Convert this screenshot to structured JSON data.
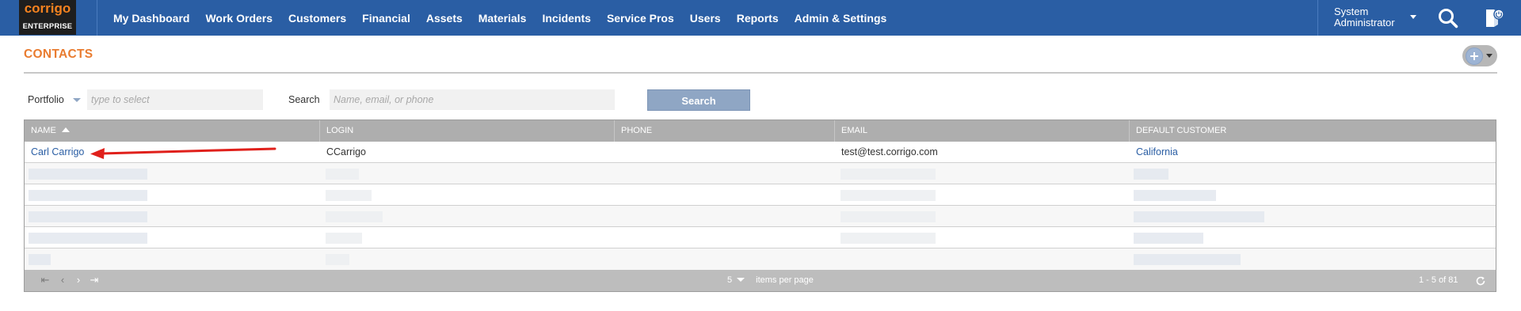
{
  "app": {
    "logo_text": "corrigo",
    "logo_sub": "ENTERPRISE",
    "nav": [
      "My Dashboard",
      "Work Orders",
      "Customers",
      "Financial",
      "Assets",
      "Materials",
      "Incidents",
      "Service Pros",
      "Users",
      "Reports",
      "Admin & Settings"
    ],
    "user_line1": "System",
    "user_line2": "Administrator",
    "icons": [
      "search-icon",
      "logout-icon"
    ]
  },
  "page": {
    "title": "CONTACTS"
  },
  "filters": {
    "portfolio_label": "Portfolio",
    "portfolio_placeholder": "type to select",
    "search_label": "Search",
    "search_placeholder": "Name, email, or phone",
    "search_button": "Search"
  },
  "grid": {
    "columns": [
      "NAME",
      "LOGIN",
      "PHONE",
      "EMAIL",
      "DEFAULT CUSTOMER"
    ],
    "sorted_column": "NAME",
    "sort_direction": "ascending",
    "rows": [
      {
        "name": "Carl Carrigo",
        "login": "CCarrigo",
        "phone": "",
        "email": "test@test.corrigo.com",
        "default_customer": "California"
      }
    ],
    "redacted_rows": 5,
    "page_size": "5",
    "per_page_label": "items per page",
    "range_text": "1 - 5 of 81"
  },
  "colors": {
    "topbar": "#2a5ea4",
    "brand_orange": "#f5821f",
    "title_orange": "#e97c30",
    "annotation_arrow": "#e0201b"
  }
}
